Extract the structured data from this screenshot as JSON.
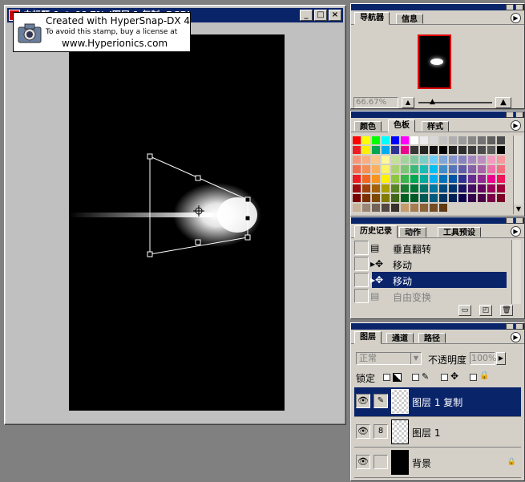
{
  "document_window": {
    "title": "未标题-1 @ 66.7% (图层 1 复制, RGB)"
  },
  "watermark": {
    "line1": "Created with HyperSnap-DX 4",
    "line2": "To avoid this stamp, buy a license at",
    "line3": "www.Hyperionics.com"
  },
  "navigator": {
    "tabs": [
      "导航器",
      "信息"
    ],
    "zoom": "66.67%"
  },
  "swatches": {
    "tabs": [
      "颜色",
      "色板",
      "样式"
    ],
    "colors": [
      "#ff0000",
      "#ffff00",
      "#00ff00",
      "#00ffff",
      "#0000ff",
      "#ff00ff",
      "#ffffff",
      "#ebebeb",
      "#d7d7d7",
      "#c3c3c3",
      "#afafaf",
      "#9b9b9b",
      "#878787",
      "#737373",
      "#5f5f5f",
      "#4b4b4b",
      "#ed1c24",
      "#fff200",
      "#00a651",
      "#00aeef",
      "#2e3192",
      "#ec008c",
      "#373737",
      "#232323",
      "#0f0f0f",
      "#000000",
      "#1e1e1e",
      "#2d2d2d",
      "#3c3c3c",
      "#4b4b4b",
      "#5a5a5a",
      "#000000",
      "#f7977a",
      "#fbad82",
      "#fdc68c",
      "#fff799",
      "#c4df9b",
      "#a3d39c",
      "#82ca9d",
      "#7bcdc8",
      "#6ecff6",
      "#7ea7d8",
      "#8493ca",
      "#8882be",
      "#a187be",
      "#bc8dbf",
      "#f49ac1",
      "#f5989d",
      "#f26c4f",
      "#f68e56",
      "#fbaf5d",
      "#fff467",
      "#acd372",
      "#7cc576",
      "#3bb878",
      "#1abbb4",
      "#00bff3",
      "#438ccb",
      "#5574b9",
      "#605ca8",
      "#855fa8",
      "#a763a8",
      "#f06ea9",
      "#f26d7d",
      "#ed1c24",
      "#f26522",
      "#f7941d",
      "#fff200",
      "#8dc63f",
      "#39b54a",
      "#00a651",
      "#00a99d",
      "#00aeef",
      "#0072bc",
      "#0054a6",
      "#2e3192",
      "#662d91",
      "#92278f",
      "#ec008c",
      "#ed145b",
      "#9e0b0f",
      "#a0410d",
      "#a36209",
      "#aba000",
      "#598527",
      "#1a7b30",
      "#007236",
      "#00746b",
      "#0076a3",
      "#004b80",
      "#003471",
      "#1b1464",
      "#440e62",
      "#630460",
      "#9e005d",
      "#9e0039",
      "#790000",
      "#7b2e00",
      "#7d4900",
      "#827b00",
      "#406618",
      "#005e20",
      "#005826",
      "#005952",
      "#005b7f",
      "#003663",
      "#002157",
      "#0d004c",
      "#32004b",
      "#4b0049",
      "#7b0046",
      "#7a0026",
      "#c7b299",
      "#998675",
      "#736357",
      "#534741",
      "#37302a",
      "#c69c6d",
      "#a67c52",
      "#8c6239",
      "#754c24",
      "#603913",
      "#d4d0c8"
    ]
  },
  "history": {
    "tabs": [
      "历史记录",
      "动作",
      "工具预设"
    ],
    "items": [
      {
        "label": "垂直翻转",
        "icon": "document-icon",
        "selected": false,
        "dim": false
      },
      {
        "label": "移动",
        "icon": "move-icon",
        "selected": false,
        "dim": false
      },
      {
        "label": "移动",
        "icon": "move-icon",
        "selected": true,
        "dim": false
      },
      {
        "label": "自由变换",
        "icon": "document-icon",
        "selected": false,
        "dim": true
      }
    ]
  },
  "layers": {
    "tabs": [
      "图层",
      "通道",
      "路径"
    ],
    "blend_mode": "正常",
    "opacity_label": "不透明度",
    "opacity_value": "100%",
    "lock_label": "锁定",
    "rows": [
      {
        "name": "图层 1 复制",
        "selected": true,
        "thumb": "transparent"
      },
      {
        "name": "图层 1",
        "selected": false,
        "thumb": "transparent"
      },
      {
        "name": "背景",
        "selected": false,
        "thumb": "black"
      }
    ]
  }
}
